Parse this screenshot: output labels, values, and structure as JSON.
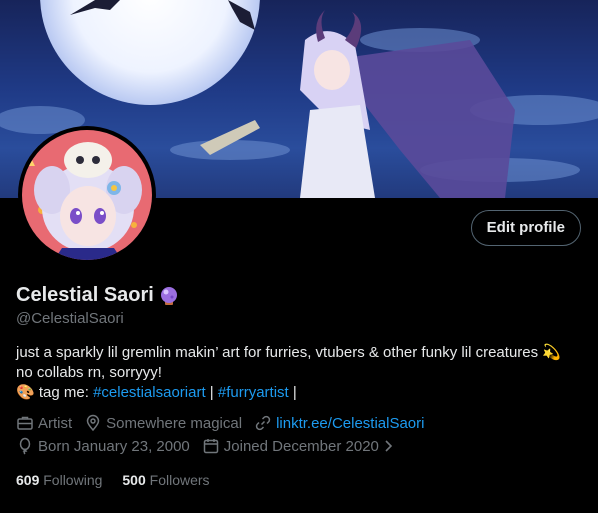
{
  "profile": {
    "display_name": "Celestial Saori",
    "handle": "@CelestialSaori",
    "edit_button": "Edit profile",
    "bio": {
      "line1": "just a sparkly lil gremlin makin’ art for furries, vtubers & other funky lil creatures",
      "line1_emoji": "💫",
      "line2": "no collabs rn, sorryyy!",
      "line3_emoji": "🎨",
      "line3_prefix": "tag me:",
      "hashtag1": "#celestialsaoriart",
      "separator1": "|",
      "hashtag2": "#furryartist",
      "separator2": "|"
    },
    "meta": {
      "occupation": "Artist",
      "location": "Somewhere magical",
      "website": "linktr.ee/CelestialSaori",
      "birthday": "Born January 23, 2000",
      "joined": "Joined December 2020"
    },
    "stats": {
      "following_count": "609",
      "following_label": "Following",
      "followers_count": "500",
      "followers_label": "Followers"
    }
  },
  "colors": {
    "background": "#000000",
    "text_primary": "#e7e9ea",
    "text_secondary": "#71767b",
    "link": "#1d9bf0",
    "border": "#536471"
  },
  "icons": {
    "verified_badge": "purple-crystal-ball-icon",
    "occupation": "briefcase-icon",
    "location": "location-pin-icon",
    "website": "link-icon",
    "birthday": "balloon-icon",
    "joined": "calendar-icon"
  }
}
